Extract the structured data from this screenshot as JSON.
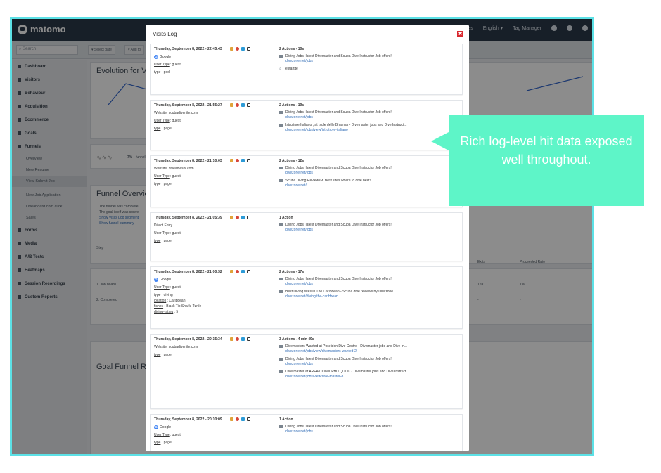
{
  "app": {
    "logo": "matomo"
  },
  "topnav": {
    "sites": "sites",
    "language": "English ▾",
    "tag_manager": "Tag Manager"
  },
  "search": {
    "placeholder": "Search"
  },
  "subbar": {
    "btn1": "▾ Select date",
    "btn2": "▾ Add to"
  },
  "sidebar": {
    "items": [
      {
        "label": "Dashboard"
      },
      {
        "label": "Visitors"
      },
      {
        "label": "Behaviour"
      },
      {
        "label": "Acquisition"
      },
      {
        "label": "Ecommerce"
      },
      {
        "label": "Goals"
      },
      {
        "label": "Funnels"
      }
    ],
    "funnel_subitems": [
      "Overview",
      "New Resume",
      "View Submit Job",
      "New Job Application",
      "Liveaboard.com click",
      "Sales"
    ],
    "items2": [
      {
        "label": "Forms"
      },
      {
        "label": "Media"
      },
      {
        "label": "A/B Tests"
      },
      {
        "label": "Heatmaps"
      },
      {
        "label": "Session Recordings"
      },
      {
        "label": "Custom Reports"
      }
    ]
  },
  "main": {
    "evolution_title": "Evolution for Vi",
    "sparkline_value": "7%",
    "sparkline_label": "funnel c",
    "funnel_overview_title": "Funnel Overview",
    "funnel_lines": [
      "The funnel was complete",
      "The goal itself was conve",
      "Show Visits Log segment",
      "Show funnel summary"
    ],
    "table": {
      "step": "Step",
      "row1": "1. Job board",
      "row2": "2. Completed",
      "exits": "Exits",
      "proceeded_rate": "Proceeded Rate",
      "row1_exits": "159",
      "row1_rate": "1%",
      "row2_exits": "-",
      "row2_rate": "-"
    },
    "goal_funnel_title": "Goal Funnel Rep"
  },
  "modal": {
    "title": "Visits Log",
    "close": "✖",
    "visits": [
      {
        "date": "Thursday, September 8, 2022 - 22:45:43",
        "source": "Google",
        "source_type": "google",
        "user_type": "guest",
        "extra": [
          {
            "k": "type",
            "v": "pool"
          }
        ],
        "header": "2 Actions - 10s",
        "actions": [
          {
            "title": "Diving Jobs, latest Divemaster and Scuba Dive Instructor Job offers!",
            "url": "divezone.net/jobs",
            "kind": "page"
          },
          {
            "title": "estartite",
            "url": "",
            "kind": "search"
          }
        ],
        "height": 73
      },
      {
        "date": "Thursday, September 8, 2022 - 21:55:27",
        "source": "Website: scubadiverlife.com",
        "source_type": "website",
        "user_type": "guest",
        "extra": [
          {
            "k": "type",
            "v": "page"
          }
        ],
        "header": "2 Actions - 19s",
        "actions": [
          {
            "title": "Diving Jobs, latest Divemaster and Scuba Dive Instructor Job offers!",
            "url": "divezone.net/jobs",
            "kind": "page"
          },
          {
            "title": "Istruttore Italiano , at Isole delle Bhamas - Divemaster jobs and Dive Instruct...",
            "url": "divezone.net/jobs/view/istruttore-italiano",
            "kind": "page"
          }
        ],
        "height": 72
      },
      {
        "date": "Thursday, September 8, 2022 - 21:10:03",
        "source": "Website: diveadvisor.com",
        "source_type": "website",
        "user_type": "guest",
        "extra": [
          {
            "k": "type",
            "v": "page"
          }
        ],
        "header": "2 Actions - 12s",
        "actions": [
          {
            "title": "Diving Jobs, latest Divemaster and Scuba Dive Instructor Job offers!",
            "url": "divezone.net/jobs",
            "kind": "page"
          },
          {
            "title": "Scuba Diving Reviews & Best sites where to dive next!",
            "url": "divezone.net/",
            "kind": "page"
          }
        ],
        "height": 74
      },
      {
        "date": "Thursday, September 8, 2022 - 21:05:39",
        "source": "Direct Entry",
        "source_type": "direct",
        "user_type": "guest",
        "extra": [
          {
            "k": "type",
            "v": "page"
          }
        ],
        "header": "1 Action",
        "actions": [
          {
            "title": "Diving Jobs, latest Divemaster and Scuba Dive Instructor Job offers!",
            "url": "divezone.net/jobs",
            "kind": "page"
          }
        ],
        "height": 70
      },
      {
        "date": "Thursday, September 8, 2022 - 21:00:32",
        "source": "Google",
        "source_type": "google",
        "user_type": "guest",
        "extra": [
          {
            "k": "type",
            "v": "diving"
          },
          {
            "k": "location",
            "v": "Caribbean"
          },
          {
            "k": "fishes",
            "v": "Black Tip Shark, Turtle"
          },
          {
            "k": "diving-rating",
            "v": "5"
          }
        ],
        "header": "2 Actions - 17s",
        "actions": [
          {
            "title": "Diving Jobs, latest Divemaster and Scuba Dive Instructor Job offers!",
            "url": "divezone.net/jobs",
            "kind": "page"
          },
          {
            "title": "Best Diving sites in The Caribbean - Scuba dive reviews by Divezone",
            "url": "divezone.net/diving/the-caribbean",
            "kind": "page"
          }
        ],
        "height": 89
      },
      {
        "date": "Thursday, September 8, 2022 - 20:15:34",
        "source": "Website: scubadiverlife.com",
        "source_type": "website",
        "user_type": "",
        "extra": [
          {
            "k": "type",
            "v": "page"
          }
        ],
        "header": "3 Actions - 4 min 49s",
        "actions": [
          {
            "title": "Divemasters Wanted at Poseidon Dive Centre - Divemaster jobs and Dive In...",
            "url": "divezone.net/jobs/view/divemasters-wanted-2",
            "kind": "page"
          },
          {
            "title": "Diving Jobs, latest Divemaster and Scuba Dive Instructor Job offers!",
            "url": "divezone.net/jobs",
            "kind": "page"
          },
          {
            "title": "Dive master at AREA11Diver PHU QUOC - Divemaster jobs and Dive Instruct...",
            "url": "divezone.net/jobs/view/dive-master-8",
            "kind": "page"
          }
        ],
        "height": 107
      },
      {
        "date": "Thursday, September 8, 2022 - 20:10:09",
        "source": "Google",
        "source_type": "google",
        "user_type": "guest",
        "extra": [
          {
            "k": "type",
            "v": "page"
          }
        ],
        "header": "1 Action",
        "actions": [
          {
            "title": "Diving Jobs, latest Divemaster and Scuba Dive Instructor Job offers!",
            "url": "divezone.net/jobs",
            "kind": "page"
          }
        ],
        "height": 75
      }
    ]
  },
  "callout": {
    "text": "Rich log-level hit data exposed well throughout."
  },
  "colors": {
    "accent_border": "#5ce1e6",
    "callout_bg": "#5ef5c8",
    "topbar": "#2b3a4a",
    "link": "#2f6bb5",
    "close_red": "#d9282f"
  }
}
